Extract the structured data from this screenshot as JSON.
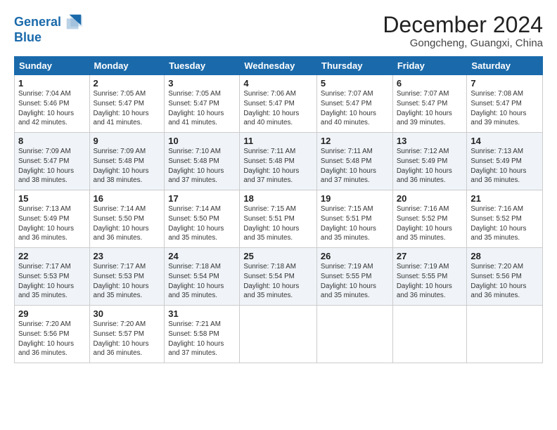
{
  "header": {
    "logo_line1": "General",
    "logo_line2": "Blue",
    "month": "December 2024",
    "location": "Gongcheng, Guangxi, China"
  },
  "weekdays": [
    "Sunday",
    "Monday",
    "Tuesday",
    "Wednesday",
    "Thursday",
    "Friday",
    "Saturday"
  ],
  "weeks": [
    [
      {
        "day": "1",
        "sunrise": "7:04 AM",
        "sunset": "5:46 PM",
        "daylight": "10 hours and 42 minutes."
      },
      {
        "day": "2",
        "sunrise": "7:05 AM",
        "sunset": "5:47 PM",
        "daylight": "10 hours and 41 minutes."
      },
      {
        "day": "3",
        "sunrise": "7:05 AM",
        "sunset": "5:47 PM",
        "daylight": "10 hours and 41 minutes."
      },
      {
        "day": "4",
        "sunrise": "7:06 AM",
        "sunset": "5:47 PM",
        "daylight": "10 hours and 40 minutes."
      },
      {
        "day": "5",
        "sunrise": "7:07 AM",
        "sunset": "5:47 PM",
        "daylight": "10 hours and 40 minutes."
      },
      {
        "day": "6",
        "sunrise": "7:07 AM",
        "sunset": "5:47 PM",
        "daylight": "10 hours and 39 minutes."
      },
      {
        "day": "7",
        "sunrise": "7:08 AM",
        "sunset": "5:47 PM",
        "daylight": "10 hours and 39 minutes."
      }
    ],
    [
      {
        "day": "8",
        "sunrise": "7:09 AM",
        "sunset": "5:47 PM",
        "daylight": "10 hours and 38 minutes."
      },
      {
        "day": "9",
        "sunrise": "7:09 AM",
        "sunset": "5:48 PM",
        "daylight": "10 hours and 38 minutes."
      },
      {
        "day": "10",
        "sunrise": "7:10 AM",
        "sunset": "5:48 PM",
        "daylight": "10 hours and 37 minutes."
      },
      {
        "day": "11",
        "sunrise": "7:11 AM",
        "sunset": "5:48 PM",
        "daylight": "10 hours and 37 minutes."
      },
      {
        "day": "12",
        "sunrise": "7:11 AM",
        "sunset": "5:48 PM",
        "daylight": "10 hours and 37 minutes."
      },
      {
        "day": "13",
        "sunrise": "7:12 AM",
        "sunset": "5:49 PM",
        "daylight": "10 hours and 36 minutes."
      },
      {
        "day": "14",
        "sunrise": "7:13 AM",
        "sunset": "5:49 PM",
        "daylight": "10 hours and 36 minutes."
      }
    ],
    [
      {
        "day": "15",
        "sunrise": "7:13 AM",
        "sunset": "5:49 PM",
        "daylight": "10 hours and 36 minutes."
      },
      {
        "day": "16",
        "sunrise": "7:14 AM",
        "sunset": "5:50 PM",
        "daylight": "10 hours and 36 minutes."
      },
      {
        "day": "17",
        "sunrise": "7:14 AM",
        "sunset": "5:50 PM",
        "daylight": "10 hours and 35 minutes."
      },
      {
        "day": "18",
        "sunrise": "7:15 AM",
        "sunset": "5:51 PM",
        "daylight": "10 hours and 35 minutes."
      },
      {
        "day": "19",
        "sunrise": "7:15 AM",
        "sunset": "5:51 PM",
        "daylight": "10 hours and 35 minutes."
      },
      {
        "day": "20",
        "sunrise": "7:16 AM",
        "sunset": "5:52 PM",
        "daylight": "10 hours and 35 minutes."
      },
      {
        "day": "21",
        "sunrise": "7:16 AM",
        "sunset": "5:52 PM",
        "daylight": "10 hours and 35 minutes."
      }
    ],
    [
      {
        "day": "22",
        "sunrise": "7:17 AM",
        "sunset": "5:53 PM",
        "daylight": "10 hours and 35 minutes."
      },
      {
        "day": "23",
        "sunrise": "7:17 AM",
        "sunset": "5:53 PM",
        "daylight": "10 hours and 35 minutes."
      },
      {
        "day": "24",
        "sunrise": "7:18 AM",
        "sunset": "5:54 PM",
        "daylight": "10 hours and 35 minutes."
      },
      {
        "day": "25",
        "sunrise": "7:18 AM",
        "sunset": "5:54 PM",
        "daylight": "10 hours and 35 minutes."
      },
      {
        "day": "26",
        "sunrise": "7:19 AM",
        "sunset": "5:55 PM",
        "daylight": "10 hours and 35 minutes."
      },
      {
        "day": "27",
        "sunrise": "7:19 AM",
        "sunset": "5:55 PM",
        "daylight": "10 hours and 36 minutes."
      },
      {
        "day": "28",
        "sunrise": "7:20 AM",
        "sunset": "5:56 PM",
        "daylight": "10 hours and 36 minutes."
      }
    ],
    [
      {
        "day": "29",
        "sunrise": "7:20 AM",
        "sunset": "5:56 PM",
        "daylight": "10 hours and 36 minutes."
      },
      {
        "day": "30",
        "sunrise": "7:20 AM",
        "sunset": "5:57 PM",
        "daylight": "10 hours and 36 minutes."
      },
      {
        "day": "31",
        "sunrise": "7:21 AM",
        "sunset": "5:58 PM",
        "daylight": "10 hours and 37 minutes."
      },
      null,
      null,
      null,
      null
    ]
  ],
  "labels": {
    "sunrise": "Sunrise:",
    "sunset": "Sunset:",
    "daylight": "Daylight:"
  }
}
